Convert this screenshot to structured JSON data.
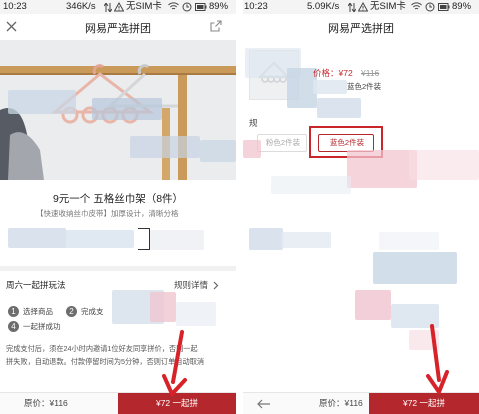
{
  "colors": {
    "brand_red": "#b4282d",
    "outline_red": "#c8262b",
    "price_red": "#c8262b",
    "arrow_red": "#d8222a",
    "status_bg": "#f4f4f4",
    "panel_bg": "#fafafa",
    "hanger_pink": "#e9b5a9",
    "wood": "#c99a5a"
  },
  "left": {
    "status": {
      "time": "10:23",
      "speed": "346K/s",
      "sim": "无SIM卡",
      "battery": "89%"
    },
    "header": {
      "title": "网易严选拼团",
      "close_icon": "close-icon",
      "share_icon": "share-icon"
    },
    "product": {
      "title": "9元一个 五格丝巾架（8件）",
      "subtitle": "【快速收纳丝巾皮带】加厚设计，清晰分格"
    },
    "rules": {
      "heading": "周六一起拼玩法",
      "detail_link": "规则详情",
      "steps": [
        {
          "num": "1",
          "label": "选择商品"
        },
        {
          "num": "2",
          "label": "完成支"
        },
        {
          "num": "4",
          "label": "一起拼成功"
        }
      ],
      "description_line1": "完成支付后，须在24小时内邀请1位好友同享拼价，否则一起",
      "description_line2": "拼失败，自动退款。付款停留时间为5分钟，否则订单自动取消"
    },
    "bottom_bar": {
      "original_price": "原价：¥116",
      "group_button": "¥72 一起拼"
    }
  },
  "right": {
    "status": {
      "time": "10:23",
      "speed": "5.09K/s",
      "sim": "无SIM卡",
      "battery": "89%"
    },
    "header": {
      "title": "网易严选拼团"
    },
    "sku": {
      "price_label": "价格：¥72",
      "price_original": "¥116",
      "selected_text": "蓝色2件装",
      "left_label": "规",
      "option_gray": "粉色2件装",
      "option_selected": "蓝色2件装"
    },
    "bottom_bar": {
      "back_icon": "arrow-left-icon",
      "original_price": "原价：¥116",
      "group_button": "¥72 一起拼"
    }
  }
}
